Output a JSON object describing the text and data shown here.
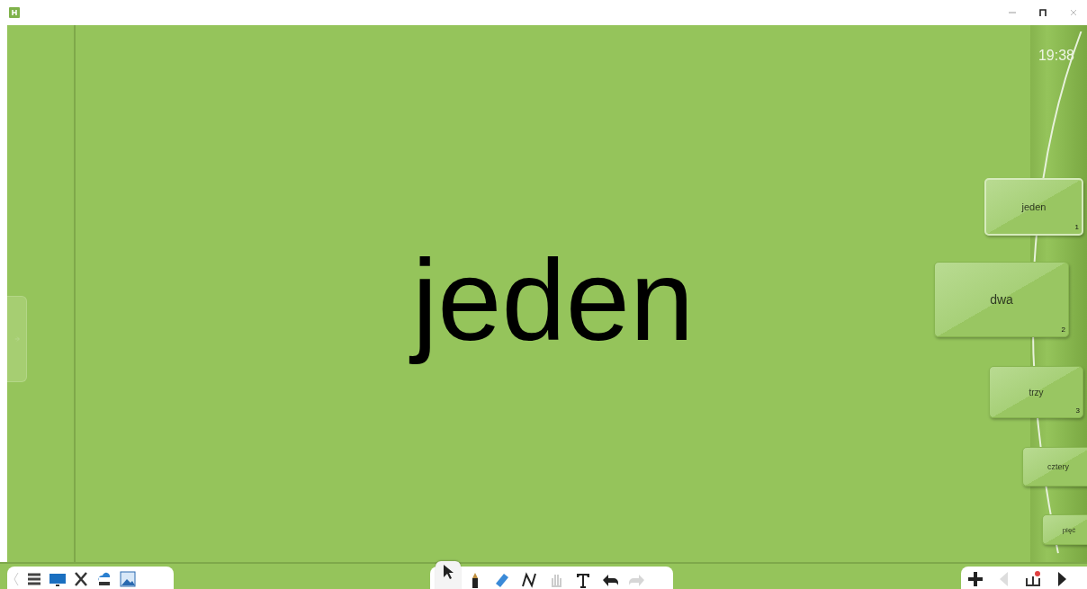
{
  "clock": "19:38",
  "slide_text": "jeden",
  "slides": [
    {
      "label": "jeden",
      "number": "1",
      "selected": true
    },
    {
      "label": "dwa",
      "number": "2",
      "selected": false
    },
    {
      "label": "trzy",
      "number": "3",
      "selected": false
    },
    {
      "label": "cztery",
      "selected": false
    },
    {
      "label": "pięć",
      "selected": false
    }
  ],
  "tools": [
    {
      "kind": "pointer",
      "selected": true
    },
    {
      "kind": "pen",
      "selected": false
    },
    {
      "kind": "eraser",
      "selected": false
    },
    {
      "kind": "curve",
      "selected": false
    },
    {
      "kind": "hand",
      "selected": false
    },
    {
      "kind": "text",
      "selected": false
    },
    {
      "kind": "undo",
      "selected": false
    },
    {
      "kind": "redo",
      "selected": false,
      "disabled": true
    }
  ]
}
